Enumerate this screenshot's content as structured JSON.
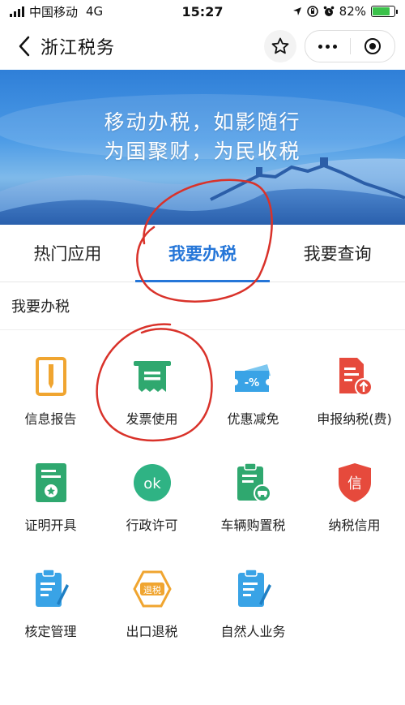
{
  "status": {
    "carrier": "中国移动",
    "network": "4G",
    "time": "15:27",
    "battery": "82%"
  },
  "nav": {
    "title": "浙江税务"
  },
  "banner": {
    "line1": "移动办税，如影随行",
    "line2": "为国聚财，为民收税"
  },
  "tabs": [
    {
      "label": "热门应用"
    },
    {
      "label": "我要办税",
      "active": true
    },
    {
      "label": "我要查询"
    }
  ],
  "section": {
    "title": "我要办税"
  },
  "items": [
    {
      "label": "信息报告",
      "icon": "report-icon"
    },
    {
      "label": "发票使用",
      "icon": "invoice-icon"
    },
    {
      "label": "优惠减免",
      "icon": "discount-icon"
    },
    {
      "label": "申报纳税(费)",
      "icon": "declare-icon"
    },
    {
      "label": "证明开具",
      "icon": "certificate-icon"
    },
    {
      "label": "行政许可",
      "icon": "ok-icon",
      "icon_text": "ok"
    },
    {
      "label": "车辆购置税",
      "icon": "vehicle-tax-icon"
    },
    {
      "label": "纳税信用",
      "icon": "credit-shield-icon",
      "icon_text": "信"
    },
    {
      "label": "核定管理",
      "icon": "checklist-icon"
    },
    {
      "label": "出口退税",
      "icon": "export-refund-icon",
      "icon_text": "退税"
    },
    {
      "label": "自然人业务",
      "icon": "person-business-icon"
    }
  ],
  "colors": {
    "accent": "#2576d8",
    "orange": "#f0a530",
    "green": "#2fa86f",
    "red": "#e64a3c",
    "blue": "#39a3e6",
    "annotation": "#d9322a"
  }
}
